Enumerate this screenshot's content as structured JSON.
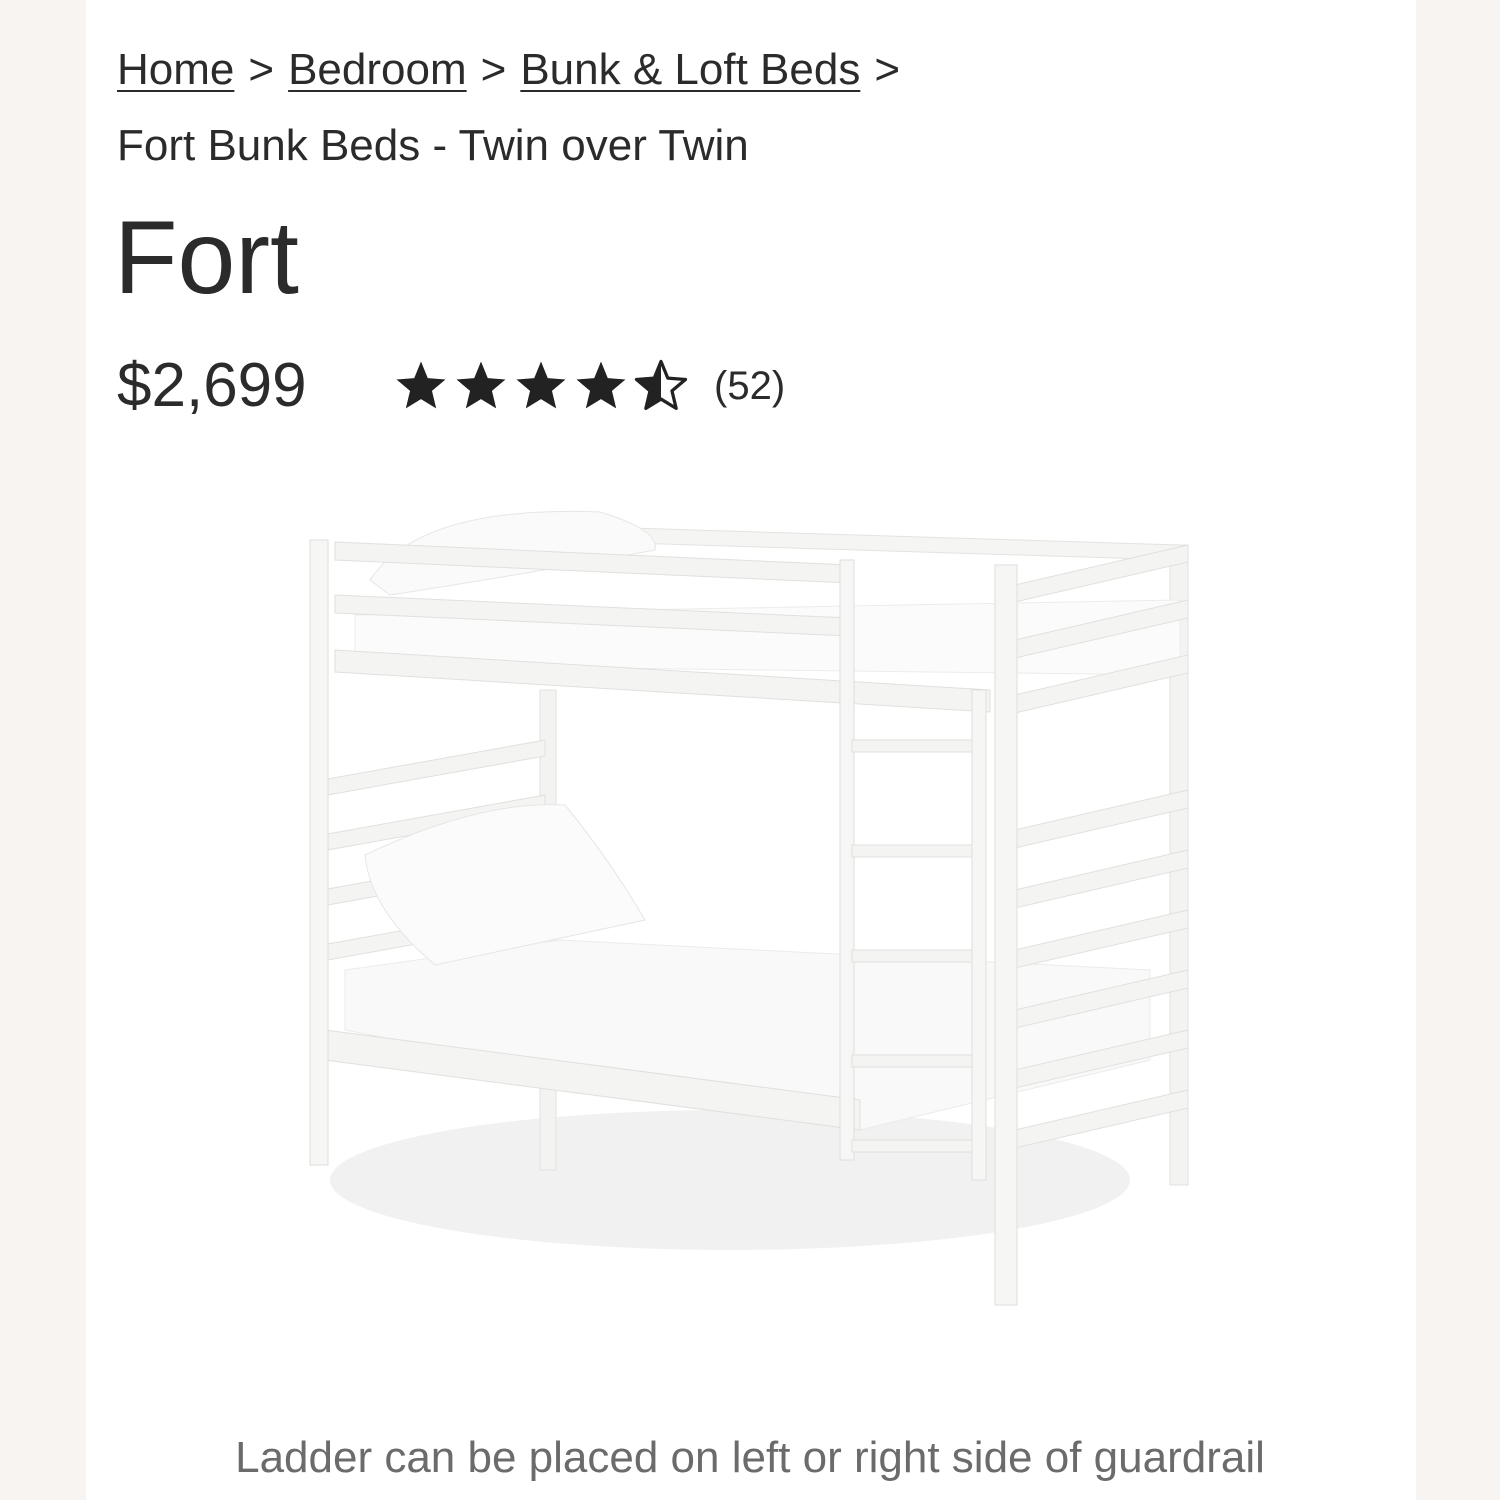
{
  "breadcrumb": {
    "items": [
      "Home",
      "Bedroom",
      "Bunk & Loft Beds"
    ],
    "separator": ">",
    "current": "Fort Bunk Beds - Twin over Twin"
  },
  "product": {
    "title": "Fort",
    "price": "$2,699",
    "rating": 4.5,
    "rating_max": 5,
    "review_count": "(52)",
    "image_alt": "white bunk bed"
  },
  "caption": "Ladder can be placed on left or right side of guardrail",
  "colors": {
    "page_background": "#f7f4f2",
    "panel_background": "#ffffff",
    "text": "#2b2b2b",
    "caption_text": "#6b6b6b"
  },
  "icons": [
    "star-icon",
    "star-icon",
    "star-icon",
    "star-icon",
    "half-star-icon"
  ]
}
